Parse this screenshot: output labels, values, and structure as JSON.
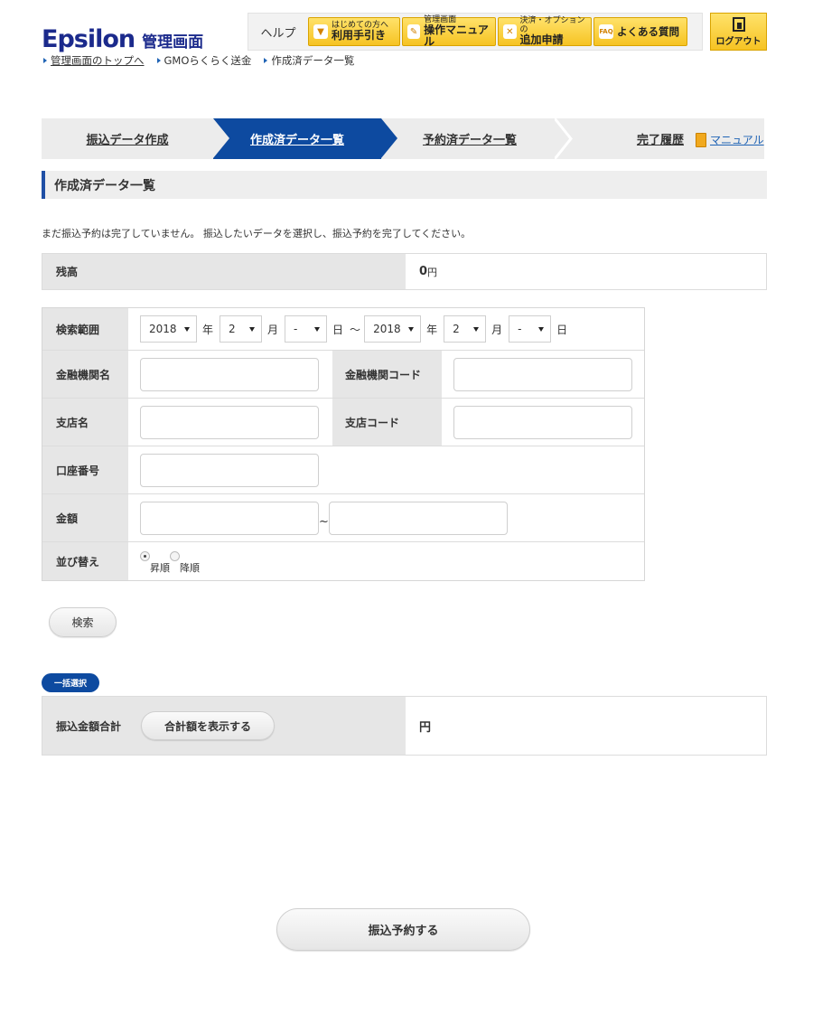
{
  "header": {
    "logo": "Epsilon",
    "logo_sub": "管理画面",
    "breadcrumb": [
      "管理画面のトップへ",
      "GMOらくらく送金",
      "作成済データ一覧"
    ]
  },
  "helpbar": {
    "label": "ヘルプ",
    "buttons": [
      {
        "small": "はじめての方へ",
        "big": "利用手引き",
        "icon": "beginner-icon"
      },
      {
        "small": "管理画面",
        "big": "操作マニュアル",
        "icon": "manual-icon"
      },
      {
        "small": "決済・オプションの",
        "big": "追加申請",
        "icon": "tools-icon"
      },
      {
        "single": "よくある質問",
        "icon": "faq-icon"
      }
    ],
    "logout": "ログアウト"
  },
  "steps": [
    "振込データ作成",
    "作成済データ一覧",
    "予約済データ一覧",
    "完了履歴"
  ],
  "manual_link": "マニュアル",
  "section_title": "作成済データ一覧",
  "notice": "まだ振込予約は完了していません。 振込したいデータを選択し、振込予約を完了してください。",
  "balance": {
    "label": "残高",
    "value": "0",
    "unit": "円"
  },
  "search": {
    "range_label": "検索範囲",
    "from_year": "2018",
    "from_month": "2",
    "from_day": "-",
    "to_year": "2018",
    "to_month": "2",
    "to_day": "-",
    "year_unit": "年",
    "month_unit": "月",
    "day_unit": "日",
    "tilde": "～",
    "bank_name_label": "金融機関名",
    "bank_code_label": "金融機関コード",
    "branch_name_label": "支店名",
    "branch_code_label": "支店コード",
    "account_label": "口座番号",
    "amount_label": "金額",
    "amount_tilde": "~",
    "sort_label": "並び替え",
    "sort_asc": "昇順",
    "sort_desc": "降順",
    "search_button": "検索"
  },
  "bulk": {
    "badge": "一括選択",
    "total_label": "振込金額合計",
    "show_total_button": "合計額を表示する",
    "total_unit": "円"
  },
  "submit_button": "振込予約する"
}
